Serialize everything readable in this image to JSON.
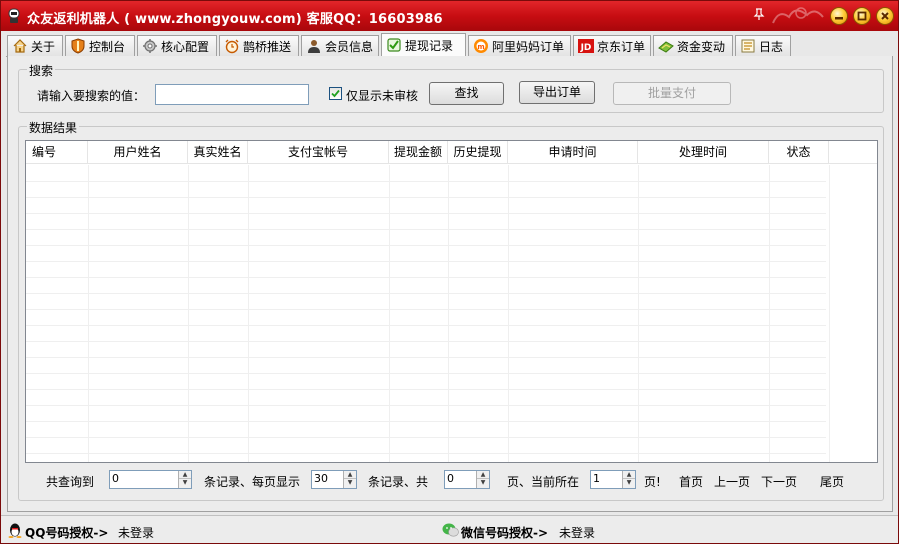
{
  "window": {
    "title": "众友返利机器人 ( www.zhongyouw.com) 客服QQ：16603986",
    "titlebar_color": "#c70d12"
  },
  "tabs": [
    {
      "label": "关于",
      "icon": "home-icon"
    },
    {
      "label": "控制台",
      "icon": "shield-icon"
    },
    {
      "label": "核心配置",
      "icon": "gear-icon"
    },
    {
      "label": "鹊桥推送",
      "icon": "alarm-clock-icon"
    },
    {
      "label": "会员信息",
      "icon": "user-icon"
    },
    {
      "label": "提现记录",
      "icon": "checkbox-icon",
      "active": true
    },
    {
      "label": "阿里妈妈订单",
      "icon": "alimama-icon"
    },
    {
      "label": "京东订单",
      "icon": "jd-icon"
    },
    {
      "label": "资金变动",
      "icon": "money-icon"
    },
    {
      "label": "日志",
      "icon": "log-icon"
    }
  ],
  "search": {
    "group_title": "搜索",
    "label": "请输入要搜索的值：",
    "value": "",
    "placeholder": "",
    "unreviewed_only_label": "仅显示未审核",
    "unreviewed_only_checked": true,
    "find_button": "查找",
    "export_button": "导出订单",
    "batch_pay_button": "批量支付"
  },
  "results": {
    "group_title": "数据结果",
    "columns": [
      "编号",
      "用户姓名",
      "真实姓名",
      "支付宝帐号",
      "提现金额",
      "历史提现",
      "申请时间",
      "处理时间",
      "状态"
    ],
    "rows": []
  },
  "pager": {
    "total_label": "共查询到",
    "total_value": "0",
    "per_page_label": "条记录、每页显示",
    "per_page_value": "30",
    "pages_label": "条记录、共",
    "pages_value": "0",
    "current_label": "页、当前所在",
    "current_value": "1",
    "page_suffix": "页!",
    "first": "首页",
    "prev": "上一页",
    "next": "下一页",
    "last": "尾页"
  },
  "status": {
    "qq_label": "QQ号码授权->",
    "qq_value": "未登录",
    "wechat_label": "微信号码授权->",
    "wechat_value": "未登录"
  }
}
